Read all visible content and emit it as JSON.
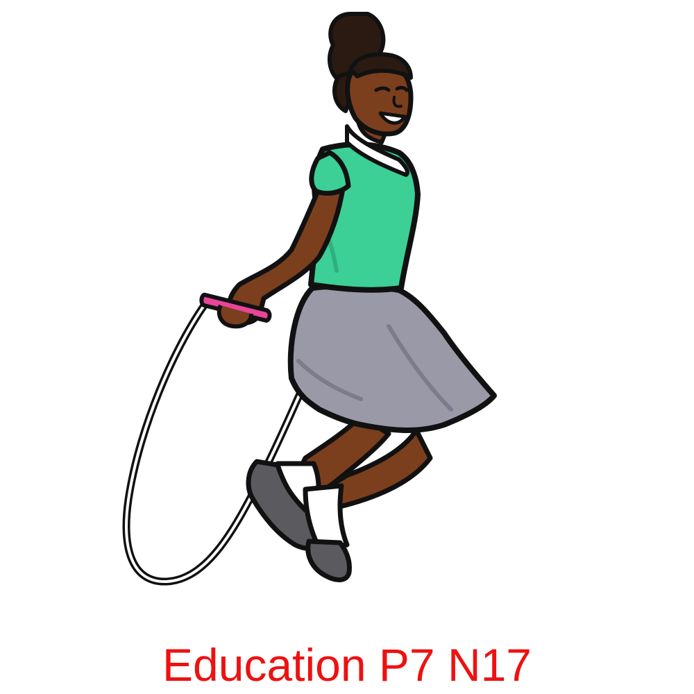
{
  "caption": {
    "text": "Education P7 N17",
    "color": "#ee1111"
  },
  "illustration": {
    "subject": "girl-jumping-rope",
    "palette": {
      "skin": "#7b3f1e",
      "skin_shadow": "#5a2c14",
      "hair": "#2a1a12",
      "shirt": "#3ccf96",
      "shirt_shadow": "#2fb07f",
      "collar": "#ffffff",
      "skirt": "#9a99a8",
      "skirt_shadow": "#7d7c8c",
      "sock": "#ffffff",
      "shoe": "#5a5a5f",
      "rope": "#ffffff",
      "handle": "#e8459a",
      "outline": "#111111"
    }
  }
}
